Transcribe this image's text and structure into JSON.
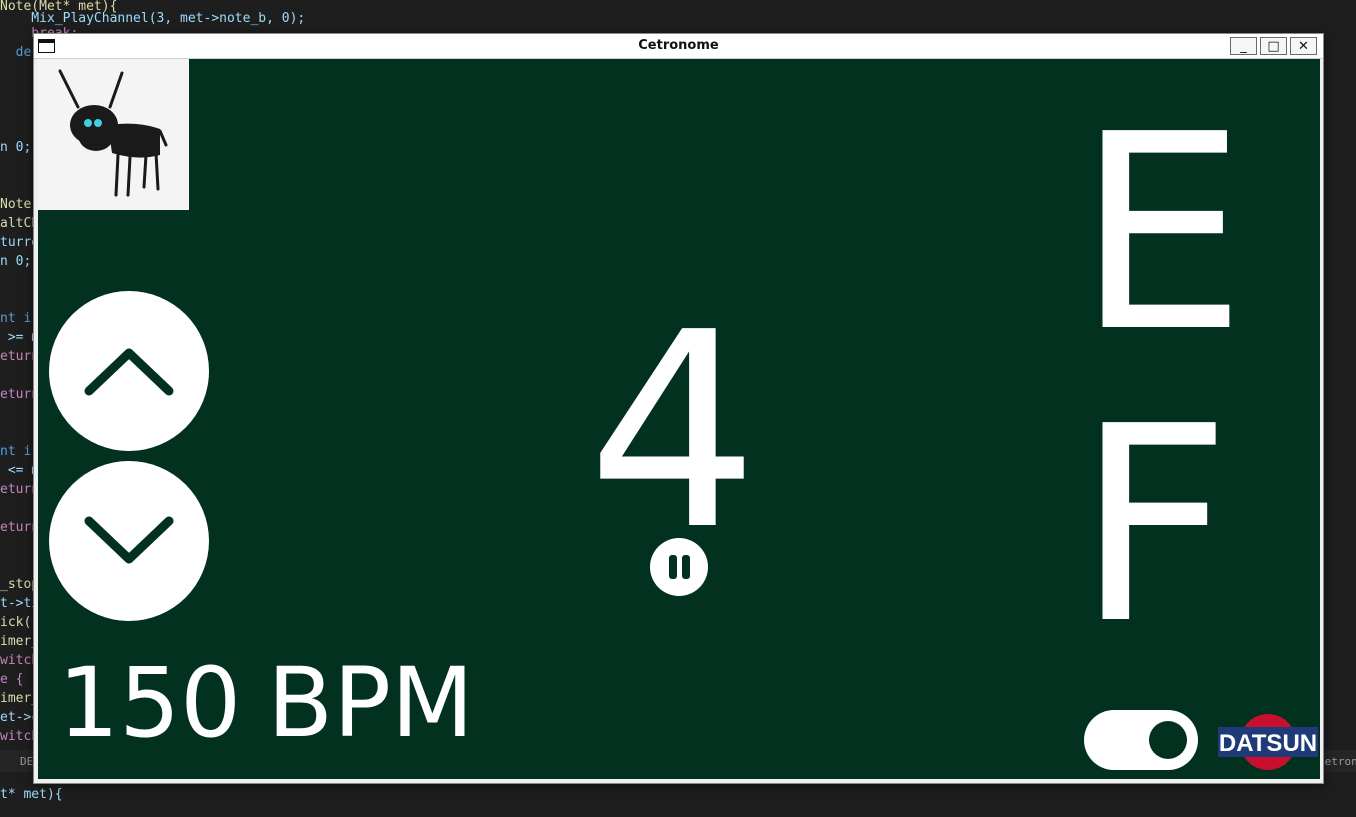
{
  "editor": {
    "lines": [
      "Note(Met* met){",
      "    Mix_PlayChannel(3, met->note_b, 0);",
      "    break;",
      "  de",
      "n 0;",
      "Note(",
      "altCh",
      "turre",
      "n 0;",
      "nt i,",
      " >= m",
      "eturn",
      "eturn",
      "nt i,",
      " <= m",
      "eturn",
      "eturn",
      "_stop",
      "t->ti",
      "ick(",
      "imer_",
      "witch",
      "e {",
      "imer_",
      "et->c",
      "witch",
      "t* met){"
    ],
    "status_left": "DE",
    "status_right": "Cetronome"
  },
  "window": {
    "title": "Cetronome",
    "minimize_label": "_",
    "maximize_label": "□",
    "close_label": "✕"
  },
  "app": {
    "mascot_icon": "donkey-drawing-icon",
    "tempo_up_icon": "chevron-up-icon",
    "tempo_down_icon": "chevron-down-icon",
    "beat_number": "4",
    "pause_icon": "pause-icon",
    "note_current": "E",
    "note_next": "F",
    "bpm_value": "150",
    "bpm_unit": "BPM",
    "sound_toggle_on": true,
    "brand_logo_text": "DATSUN",
    "colors": {
      "background": "#023120",
      "foreground": "#ffffff",
      "logo_red": "#c8102e",
      "logo_blue": "#1e3a78"
    }
  }
}
